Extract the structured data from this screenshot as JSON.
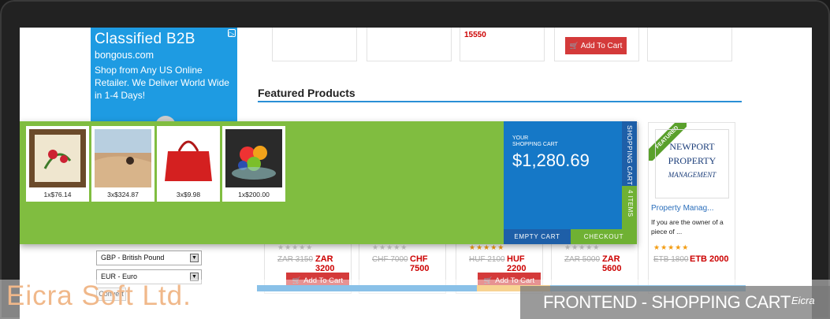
{
  "ad": {
    "title": "Classified B2B",
    "domain": "bongous.com",
    "text": "Shop from Any US Online Retailer. We Deliver World Wide in 1-4 Days!"
  },
  "top_row": {
    "price": "15550",
    "add_to_cart": "Add To Cart"
  },
  "featured": {
    "title": "Featured Products",
    "ribbon": "FEATURED"
  },
  "cart": {
    "your_label": "YOUR\nSHOPPING CART",
    "total": "$1,280.69",
    "side_label": "SHOPPING CART",
    "items_label": "4 ITEMS",
    "empty_label": "EMPTY CART",
    "checkout_label": "CHECKOUT",
    "items": [
      {
        "qty": "1x$76.14",
        "icon": "framed-flower-painting"
      },
      {
        "qty": "3x$324.87",
        "icon": "desert-rider-photo"
      },
      {
        "qty": "3x$9.98",
        "icon": "red-handbag"
      },
      {
        "qty": "1x$200.00",
        "icon": "fruit-bowl"
      }
    ]
  },
  "products": [
    {
      "old": "ZAR 3150",
      "new": "ZAR 3200",
      "stars": "★★★★★",
      "rated": false,
      "btn": "Add To Cart"
    },
    {
      "old": "CHF 7000",
      "new": "CHF 7500",
      "stars": "★★★★★",
      "rated": false,
      "btn": ""
    },
    {
      "old": "HUF 2100",
      "new": "HUF 2200",
      "stars": "★★★★★",
      "rated": true,
      "btn": "Add To Cart"
    },
    {
      "old": "ZAR 5000",
      "new": "ZAR 5600",
      "stars": "★★★★★",
      "rated": false,
      "btn": ""
    },
    {
      "old": "ETB 1800",
      "new": "ETB 2000",
      "stars": "★★★★★",
      "rated": true,
      "btn": "",
      "name": "Property Manag...",
      "desc": "If you are the owner of a piece of ...",
      "logo_line1": "NEWPORT",
      "logo_line2": "PROPERTY",
      "logo_line3": "MANAGEMENT"
    }
  ],
  "currency": {
    "options": [
      "GBP - British Pound",
      "EUR - Euro"
    ],
    "convert": "Convert"
  },
  "banner": {
    "brand": "Eicra Soft Ltd.",
    "caption": "FRONTEND - SHOPPING CART",
    "logo": "Eicra"
  },
  "colors": {
    "cart_green": "#80bd40",
    "cart_blue": "#1578c7",
    "accent_red": "#d43a3a",
    "link_blue": "#2a8fd6"
  }
}
